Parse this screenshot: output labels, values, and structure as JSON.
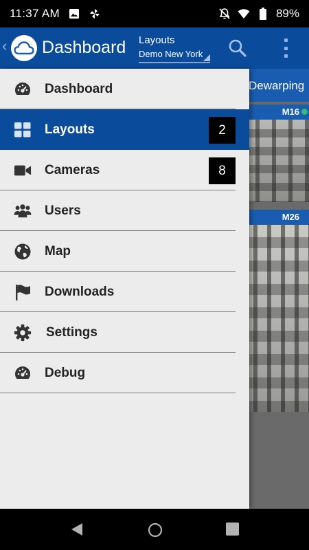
{
  "status_bar": {
    "time": "11:37",
    "time_suffix": "AM",
    "battery": "89%"
  },
  "app_bar": {
    "title": "Dashboard",
    "layout_label": "Layouts",
    "layout_value": "Demo New York"
  },
  "content": {
    "tab_label": "Dewarping",
    "cameras": [
      {
        "name": "M16"
      },
      {
        "name": "M26"
      }
    ]
  },
  "drawer": {
    "items": [
      {
        "label": "Dashboard",
        "icon": "gauge-icon"
      },
      {
        "label": "Layouts",
        "icon": "grid-icon",
        "badge": "2",
        "active": true
      },
      {
        "label": "Cameras",
        "icon": "video-camera-icon",
        "badge": "8"
      },
      {
        "label": "Users",
        "icon": "users-icon"
      },
      {
        "label": "Map",
        "icon": "globe-icon"
      },
      {
        "label": "Downloads",
        "icon": "flag-icon"
      },
      {
        "label": "Settings",
        "icon": "gear-icon"
      },
      {
        "label": "Debug",
        "icon": "gauge-icon"
      }
    ]
  },
  "colors": {
    "primary": "#0b4b9c",
    "drawer_bg": "#ececec",
    "badge_bg": "#000000",
    "status_dot": "#2fbf71"
  }
}
